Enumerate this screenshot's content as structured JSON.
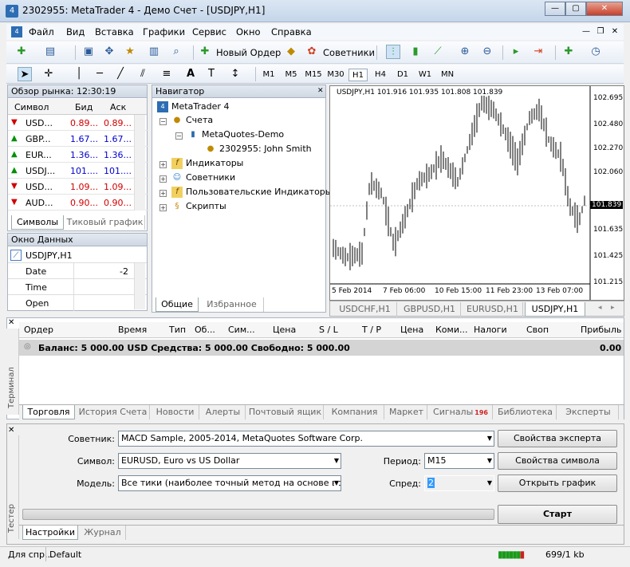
{
  "window": {
    "title": "2302955: MetaTrader 4 - Демо Счет - [USDJPY,H1]"
  },
  "menu": [
    "Файл",
    "Вид",
    "Вставка",
    "Графики",
    "Сервис",
    "Окно",
    "Справка"
  ],
  "toolbar": {
    "new_order": "Новый Ордер",
    "advisors": "Советники"
  },
  "timeframes": [
    "M1",
    "M5",
    "M15",
    "M30",
    "H1",
    "H4",
    "D1",
    "W1",
    "MN"
  ],
  "market_watch": {
    "title": "Обзор рынка: 12:30:19",
    "col_symbol": "Символ",
    "col_bid": "Бид",
    "col_ask": "Аск",
    "rows": [
      {
        "symbol": "USD...",
        "bid": "0.89...",
        "ask": "0.89...",
        "dir": "down"
      },
      {
        "symbol": "GBP...",
        "bid": "1.67...",
        "ask": "1.67...",
        "dir": "up"
      },
      {
        "symbol": "EUR...",
        "bid": "1.36...",
        "ask": "1.36...",
        "dir": "up"
      },
      {
        "symbol": "USDJ...",
        "bid": "101....",
        "ask": "101....",
        "dir": "up"
      },
      {
        "symbol": "USD...",
        "bid": "1.09...",
        "ask": "1.09...",
        "dir": "down"
      },
      {
        "symbol": "AUD...",
        "bid": "0.90...",
        "ask": "0.90...",
        "dir": "down"
      }
    ],
    "tab_symbols": "Символы",
    "tab_tick": "Тиковый график"
  },
  "data_window": {
    "title": "Окно Данных",
    "symbol": "USDJPY,H1",
    "rows": [
      {
        "label": "Date",
        "value": "-2"
      },
      {
        "label": "Time",
        "value": ""
      },
      {
        "label": "Open",
        "value": ""
      }
    ]
  },
  "navigator": {
    "title": "Навигатор",
    "root": "MetaTrader 4",
    "accounts": "Счета",
    "server": "MetaQuotes-Demo",
    "account": "2302955: John Smith",
    "indicators": "Индикаторы",
    "advisors": "Советники",
    "custom": "Пользовательские Индикаторы",
    "scripts": "Скрипты",
    "tab_common": "Общие",
    "tab_fav": "Избранное"
  },
  "chart": {
    "header": "USDJPY,H1  101.916 101.935 101.808 101.839",
    "price_ticks": [
      "102.695",
      "102.480",
      "102.270",
      "102.060",
      "101.839",
      "101.635",
      "101.425",
      "101.215"
    ],
    "time_ticks": [
      "5 Feb 2014",
      "7 Feb 06:00",
      "10 Feb 15:00",
      "11 Feb 23:00",
      "13 Feb 07:00"
    ],
    "tabs": [
      "USDCHF,H1",
      "GBPUSD,H1",
      "EURUSD,H1",
      "USDJPY,H1"
    ]
  },
  "terminal": {
    "headers": [
      "Ордер",
      "Время",
      "Тип",
      "Об...",
      "Сим...",
      "Цена",
      "S / L",
      "T / P",
      "Цена",
      "Коми...",
      "Налоги",
      "Своп",
      "Прибыль"
    ],
    "balance": "Баланс: 5 000.00 USD  Средства: 5 000.00  Свободно: 5 000.00",
    "profit": "0.00",
    "side_label": "Терминал",
    "tabs": [
      "Торговля",
      "История Счета",
      "Новости",
      "Алерты",
      "Почтовый ящик",
      "Компания",
      "Маркет",
      "Сигналы",
      "Библиотека",
      "Эксперты"
    ],
    "signals_badge": "196"
  },
  "tester": {
    "advisor_label": "Советник:",
    "advisor_value": "MACD Sample, 2005-2014, MetaQuotes Software Corp.",
    "symbol_label": "Символ:",
    "symbol_value": "EURUSD, Euro vs US Dollar",
    "model_label": "Модель:",
    "model_value": "Все тики (наиболее точный метод на основе всех",
    "period_label": "Период:",
    "period_value": "M15",
    "spread_label": "Спред:",
    "spread_value": "2",
    "btn_expert": "Свойства эксперта",
    "btn_symbol": "Свойства символа",
    "btn_chart": "Открыть график",
    "btn_start": "Старт",
    "side_label": "Тестер",
    "tab_settings": "Настройки",
    "tab_journal": "Журнал"
  },
  "status": {
    "help": "Для спр...",
    "profile": "Default",
    "traffic": "699/1 kb"
  }
}
